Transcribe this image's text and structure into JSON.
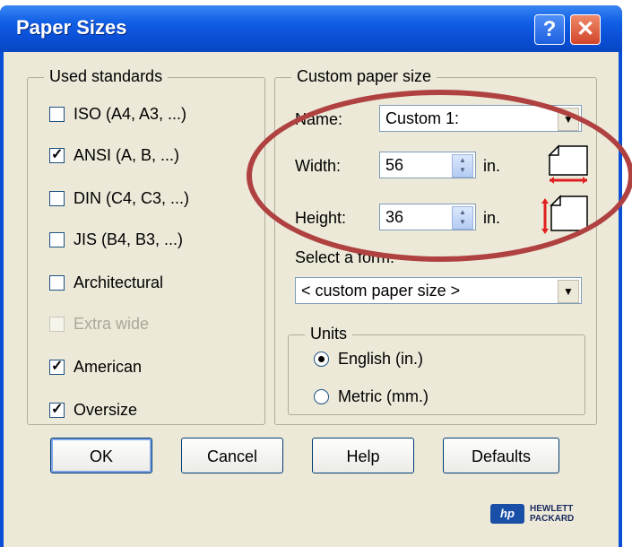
{
  "window": {
    "title": "Paper Sizes",
    "help_glyph": "?",
    "close_glyph": "✕"
  },
  "used_standards": {
    "title": "Used standards",
    "items": [
      {
        "label": "ISO (A4, A3, ...)",
        "checked": false,
        "disabled": false
      },
      {
        "label": "ANSI (A, B, ...)",
        "checked": true,
        "disabled": false
      },
      {
        "label": "DIN (C4, C3, ...)",
        "checked": false,
        "disabled": false
      },
      {
        "label": "JIS (B4, B3, ...)",
        "checked": false,
        "disabled": false
      },
      {
        "label": "Architectural",
        "checked": false,
        "disabled": false
      },
      {
        "label": "Extra wide",
        "checked": false,
        "disabled": true
      },
      {
        "label": "American",
        "checked": true,
        "disabled": false
      },
      {
        "label": "Oversize",
        "checked": true,
        "disabled": false
      }
    ]
  },
  "custom": {
    "title": "Custom paper size",
    "name_label": "Name:",
    "name_value": "Custom 1:",
    "width_label": "Width:",
    "width_value": "56",
    "height_label": "Height:",
    "height_value": "36",
    "unit": "in.",
    "form_label": "Select a form:",
    "form_value": "< custom paper size >"
  },
  "units": {
    "title": "Units",
    "options": [
      {
        "label": "English (in.)",
        "selected": true
      },
      {
        "label": "Metric (mm.)",
        "selected": false
      }
    ]
  },
  "buttons": {
    "ok": "OK",
    "cancel": "Cancel",
    "help": "Help",
    "defaults": "Defaults"
  },
  "logo": {
    "mark": "hp",
    "line1": "HEWLETT",
    "line2": "PACKARD"
  },
  "colors": {
    "titlebar": "#0a4fd6",
    "face": "#ece9d8",
    "annotation": "#b04141"
  },
  "icons": [
    "help-icon",
    "close-icon",
    "dropdown-arrow-icon",
    "spinner-icon",
    "paper-width-icon",
    "paper-height-icon"
  ]
}
